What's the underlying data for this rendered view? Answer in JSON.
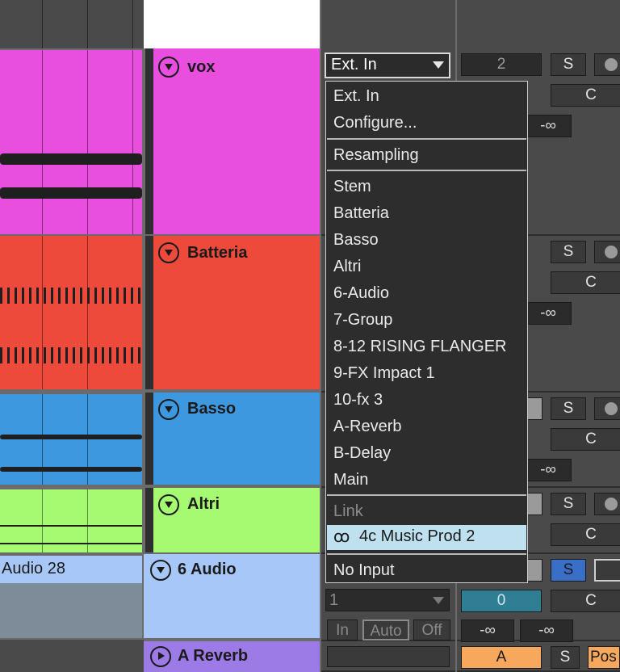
{
  "tracks": [
    {
      "name": "vox",
      "color": "#e84fdf"
    },
    {
      "name": "Batteria",
      "color": "#ee4a3c"
    },
    {
      "name": "Basso",
      "color": "#3d98e0"
    },
    {
      "name": "Altri",
      "color": "#a6fa72"
    },
    {
      "name": "6 Audio",
      "color": "#a6c7f7"
    },
    {
      "name": "A Reverb",
      "color": "#9d7be6"
    }
  ],
  "clip_audio28": "Audio 28",
  "input_select": {
    "value": "Ext. In"
  },
  "channel_select": {
    "value": "1"
  },
  "mixer": {
    "track_number": "2",
    "solo": "S",
    "pan": "C",
    "volume": "-∞",
    "volume2": "-∞",
    "send_value": "0",
    "monitor": {
      "in": "In",
      "auto": "Auto",
      "off": "Off"
    },
    "return_a": "A",
    "post": "Pos"
  },
  "menu": {
    "group1": [
      "Ext. In",
      "Configure..."
    ],
    "group2": [
      "Resampling"
    ],
    "group3": [
      "Stem",
      "Batteria",
      "Basso",
      "Altri",
      "6-Audio",
      "7-Group",
      "8-12 RISING FLANGER",
      "9-FX Impact 1",
      "10-fx 3",
      "A-Reverb",
      "B-Delay",
      "Main"
    ],
    "link_header": "Link",
    "link_item": "4c Music Prod 2",
    "no_input": "No Input"
  },
  "colors": {
    "accent": "#bfe0ef",
    "solo_active": "#3a6fc7",
    "return_orange": "#f7a85c",
    "send_teal": "#2f7e93"
  }
}
